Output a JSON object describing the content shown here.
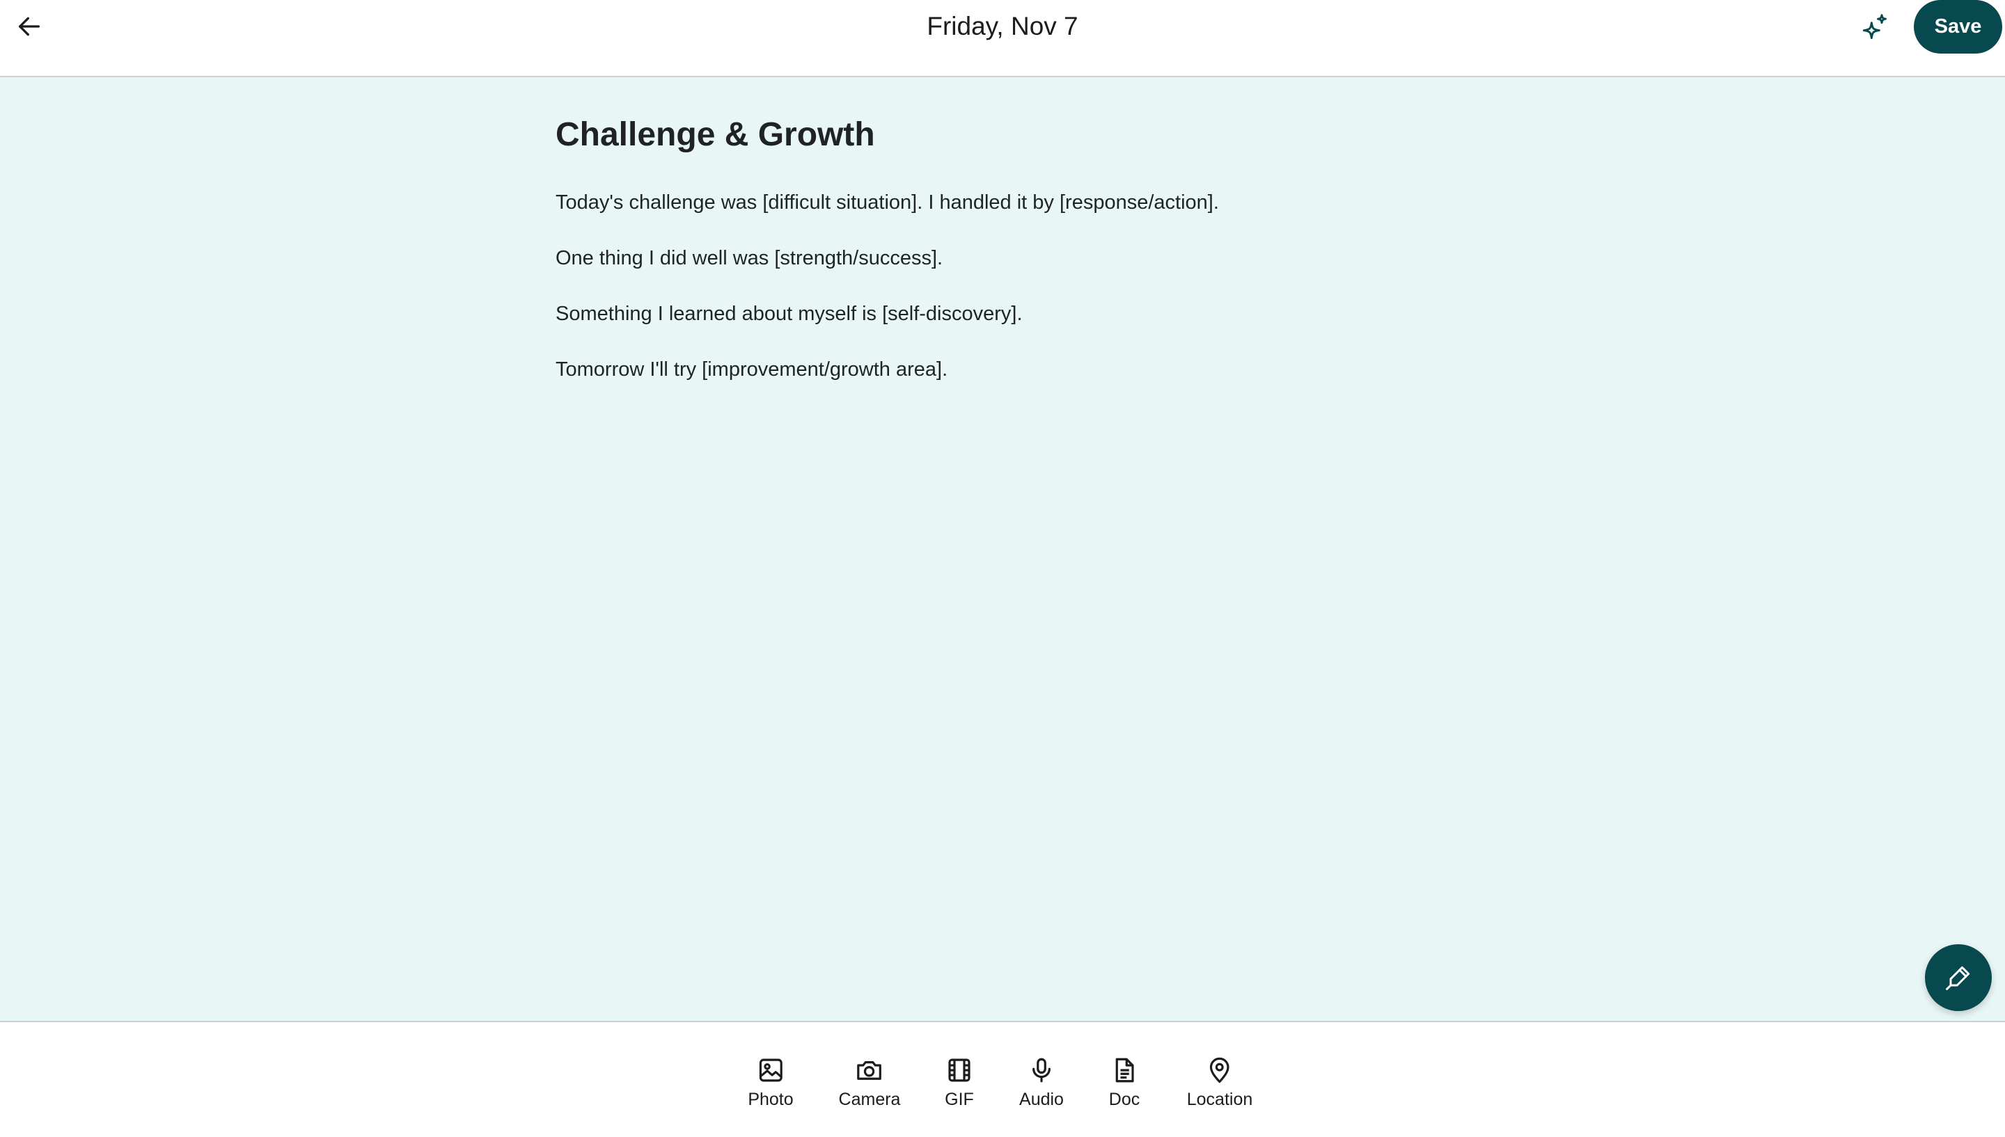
{
  "header": {
    "back_icon": "arrow-left-icon",
    "date": "Friday, Nov 7",
    "ai_icon": "sparkles-icon",
    "save_label": "Save"
  },
  "entry": {
    "title": "Challenge & Growth",
    "lines": [
      "Today's challenge was [difficult situation]. I handled it by [response/action].",
      "One thing I did well was [strength/success].",
      "Something I learned about myself is [self-discovery].",
      "Tomorrow I'll try [improvement/growth area]."
    ]
  },
  "fab": {
    "icon": "pen-icon"
  },
  "toolbar": {
    "items": [
      {
        "label": "Photo",
        "icon": "image-icon"
      },
      {
        "label": "Camera",
        "icon": "camera-icon"
      },
      {
        "label": "GIF",
        "icon": "film-icon"
      },
      {
        "label": "Audio",
        "icon": "microphone-icon"
      },
      {
        "label": "Doc",
        "icon": "document-icon"
      },
      {
        "label": "Location",
        "icon": "map-pin-icon"
      }
    ]
  },
  "colors": {
    "accent": "#07494f",
    "background": "#e9f6f6",
    "surface": "#ffffff",
    "divider": "#c9cfd2"
  }
}
